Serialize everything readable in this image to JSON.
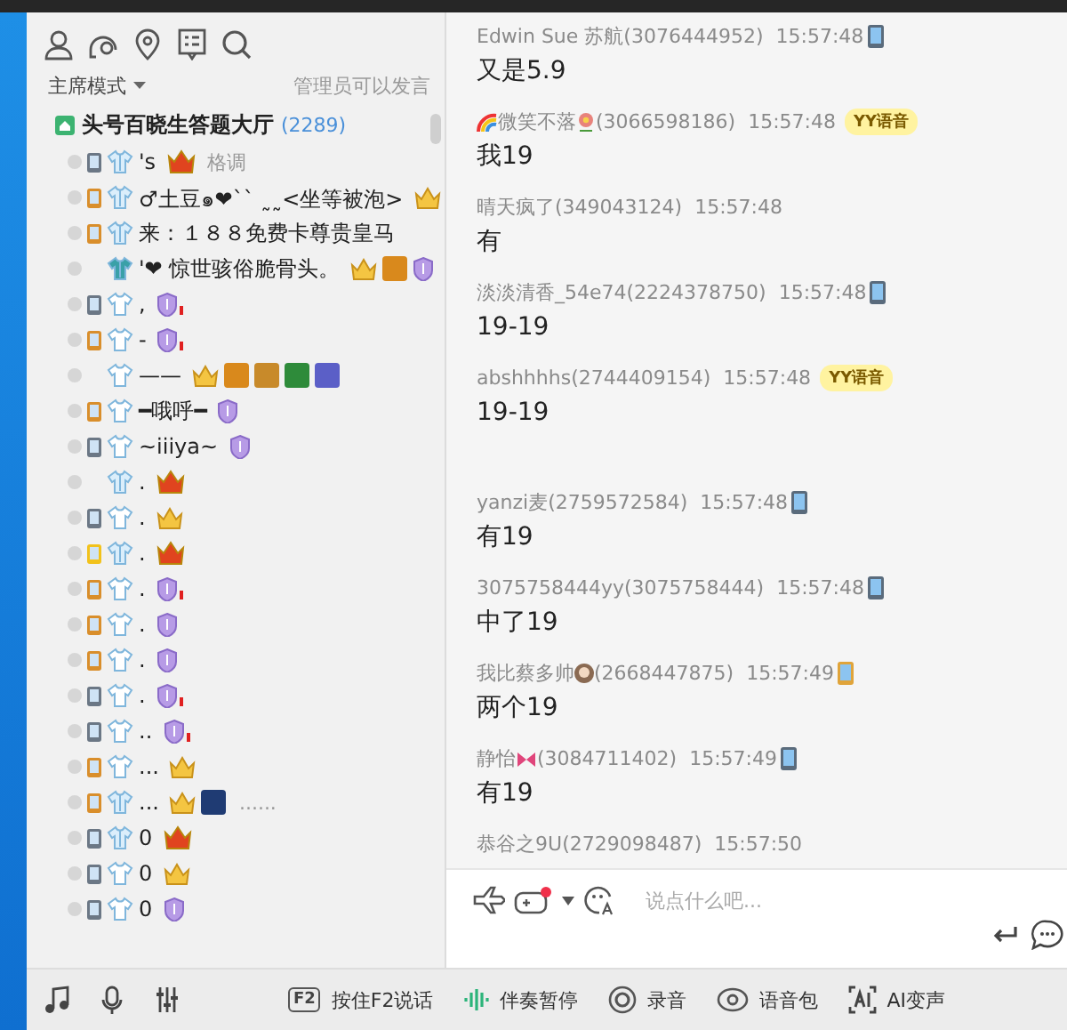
{
  "left_panel": {
    "mode": "主席模式",
    "permission": "管理员可以发言",
    "channel": {
      "name": "头号百晓生答题大厅",
      "count": "(2289)"
    },
    "members": [
      {
        "device": {
          "kind": "phone"
        },
        "shirt": {
          "kind": "solid"
        },
        "name": "'s",
        "badges": [
          {
            "kind": "crown-red"
          }
        ],
        "note": "格调"
      },
      {
        "device": {
          "kind": "gold"
        },
        "shirt": {
          "kind": "solid"
        },
        "name": "♂土豆๑❤`` ˷˷<坐等被泡>",
        "badges": [
          {
            "kind": "crown-gold"
          }
        ]
      },
      {
        "device": {
          "kind": "gold"
        },
        "shirt": {
          "kind": "solid"
        },
        "name": "来：１８８免费卡尊贵皇马"
      },
      {
        "shirt": {
          "kind": "green"
        },
        "name": "'❤  惊世骇俗脆骨头。",
        "badges": [
          {
            "kind": "crown-gold"
          },
          {
            "kind": "tile",
            "color": "#d9891c"
          },
          {
            "kind": "shield"
          }
        ]
      },
      {
        "device": {
          "kind": "phone"
        },
        "shirt": {
          "kind": "outline"
        },
        "name": ",",
        "badges": [
          {
            "kind": "shield-mark"
          }
        ]
      },
      {
        "device": {
          "kind": "gold"
        },
        "shirt": {
          "kind": "outline"
        },
        "name": "-",
        "badges": [
          {
            "kind": "shield-mark"
          }
        ]
      },
      {
        "shirt": {
          "kind": "outline"
        },
        "name": "——",
        "badges": [
          {
            "kind": "crown-gold"
          },
          {
            "kind": "tile",
            "color": "#d9891c"
          },
          {
            "kind": "tile",
            "color": "#c88a2a"
          },
          {
            "kind": "tile",
            "color": "#2e8b3a"
          },
          {
            "kind": "tile",
            "color": "#5b5fc7"
          }
        ]
      },
      {
        "device": {
          "kind": "gold"
        },
        "shirt": {
          "kind": "outline"
        },
        "name": "━哦呼━",
        "badges": [
          {
            "kind": "shield"
          }
        ]
      },
      {
        "device": {
          "kind": "phone"
        },
        "shirt": {
          "kind": "outline"
        },
        "name": "~iiiya~",
        "badges": [
          {
            "kind": "shield"
          }
        ]
      },
      {
        "shirt": {
          "kind": "solid"
        },
        "name": ".",
        "badges": [
          {
            "kind": "crown-red"
          }
        ]
      },
      {
        "device": {
          "kind": "phone"
        },
        "shirt": {
          "kind": "outline"
        },
        "name": ".",
        "badges": [
          {
            "kind": "crown-gold"
          }
        ]
      },
      {
        "device": {
          "kind": "yellow"
        },
        "shirt": {
          "kind": "solid"
        },
        "name": ".",
        "badges": [
          {
            "kind": "crown-red"
          }
        ]
      },
      {
        "device": {
          "kind": "gold"
        },
        "shirt": {
          "kind": "outline"
        },
        "name": ".",
        "badges": [
          {
            "kind": "shield-mark"
          }
        ]
      },
      {
        "device": {
          "kind": "gold"
        },
        "shirt": {
          "kind": "outline"
        },
        "name": ".",
        "badges": [
          {
            "kind": "shield"
          }
        ]
      },
      {
        "device": {
          "kind": "gold"
        },
        "shirt": {
          "kind": "outline"
        },
        "name": ".",
        "badges": [
          {
            "kind": "shield"
          }
        ]
      },
      {
        "device": {
          "kind": "phone"
        },
        "shirt": {
          "kind": "outline"
        },
        "name": ".",
        "badges": [
          {
            "kind": "shield-mark"
          }
        ]
      },
      {
        "device": {
          "kind": "phone"
        },
        "shirt": {
          "kind": "outline"
        },
        "name": "..",
        "badges": [
          {
            "kind": "shield-mark"
          }
        ]
      },
      {
        "device": {
          "kind": "gold"
        },
        "shirt": {
          "kind": "outline"
        },
        "name": "...",
        "badges": [
          {
            "kind": "crown-gold"
          }
        ]
      },
      {
        "device": {
          "kind": "gold"
        },
        "shirt": {
          "kind": "solid"
        },
        "name": "...",
        "badges": [
          {
            "kind": "crown-gold"
          },
          {
            "kind": "tile",
            "color": "#1f3b73"
          }
        ],
        "note": "......"
      },
      {
        "device": {
          "kind": "phone"
        },
        "shirt": {
          "kind": "solid"
        },
        "name": "0",
        "badges": [
          {
            "kind": "crown-red"
          }
        ]
      },
      {
        "device": {
          "kind": "phone"
        },
        "shirt": {
          "kind": "outline"
        },
        "name": "0",
        "badges": [
          {
            "kind": "crown-gold"
          }
        ]
      },
      {
        "device": {
          "kind": "phone"
        },
        "shirt": {
          "kind": "outline"
        },
        "name": "0",
        "badges": [
          {
            "kind": "shield"
          }
        ]
      }
    ]
  },
  "chat": {
    "messages": [
      {
        "name": "Edwin Sue 苏航",
        "uid": "(3076444952)",
        "time": "15:57:48",
        "badge": {
          "kind": "phone"
        },
        "text": "又是5.9"
      },
      {
        "lead_icon": {
          "kind": "rainbow"
        },
        "name": "微笑不落",
        "name_icon": {
          "kind": "flower"
        },
        "uid": "(3066598186)",
        "time": "15:57:48",
        "badge": {
          "kind": "yy",
          "label": "YY语音"
        },
        "text": "我19"
      },
      {
        "name": "晴天疯了",
        "uid": "(349043124)",
        "time": "15:57:48",
        "text": "有"
      },
      {
        "name": "淡淡清香_54e74",
        "uid": "(2224378750)",
        "time": "15:57:48",
        "badge": {
          "kind": "phone"
        },
        "text": "19-19"
      },
      {
        "name": "abshhhhs",
        "uid": "(2744409154)",
        "time": "15:57:48",
        "badge": {
          "kind": "yy",
          "label": "YY语音"
        },
        "text": "19-19",
        "spacer": true
      },
      {
        "name": "yanzi麦",
        "uid": "(2759572584)",
        "time": "15:57:48",
        "badge": {
          "kind": "phone"
        },
        "text": "有19"
      },
      {
        "name": "3075758444yy",
        "uid": "(3075758444)",
        "time": "15:57:48",
        "badge": {
          "kind": "phone"
        },
        "text": "中了19"
      },
      {
        "name": "我比蔡多帅",
        "name_icon": {
          "kind": "avatar"
        },
        "uid": "(2668447875)",
        "time": "15:57:49",
        "badge": {
          "kind": "gold"
        },
        "text": "两个19"
      },
      {
        "name": "静怡",
        "name_icon": {
          "kind": "bow"
        },
        "uid": "(3084711402)",
        "time": "15:57:49",
        "badge": {
          "kind": "phone"
        },
        "text": "有19"
      },
      {
        "name": "恭谷之9U",
        "uid": "(2729098487)",
        "time": "15:57:50"
      }
    ],
    "input": {
      "placeholder": "说点什么吧..."
    }
  },
  "bottom_bar": [
    {
      "kind": "key",
      "key": "F2",
      "label": "按住F2说话"
    },
    {
      "kind": "wave",
      "label": "伴奏暂停"
    },
    {
      "kind": "record",
      "label": "录音"
    },
    {
      "kind": "voicepack",
      "label": "语音包"
    },
    {
      "kind": "ai",
      "label": "AI变声"
    }
  ]
}
